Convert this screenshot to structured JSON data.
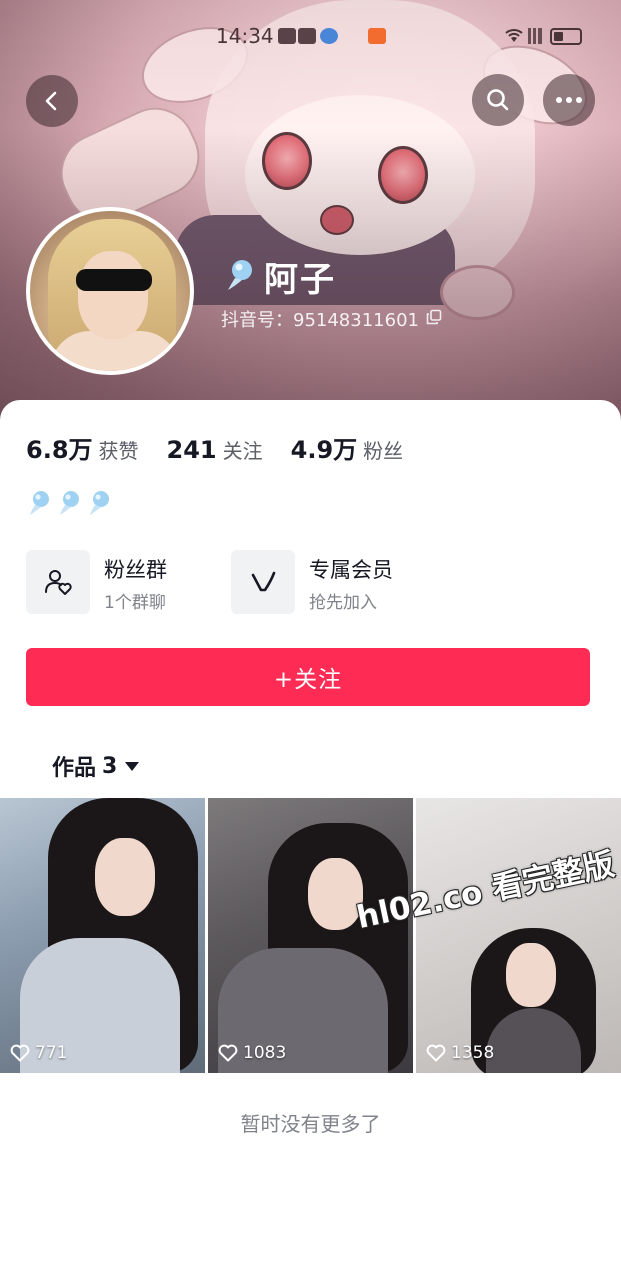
{
  "status_bar": {
    "time": "14:34",
    "icons": [
      "app-icon",
      "app-icon",
      "browser-icon",
      "app-icon",
      "wifi-icon",
      "signal-icon",
      "battery-icon"
    ]
  },
  "profile": {
    "nickname": "阿子",
    "douyin_id": "抖音号：95148311601"
  },
  "stats": {
    "likes_value": "6.8万",
    "likes_label": "获赞",
    "following_value": "241",
    "following_label": "关注",
    "followers_value": "4.9万",
    "followers_label": "粉丝"
  },
  "features": {
    "fans_group_title": "粉丝群",
    "fans_group_sub": "1个群聊",
    "vip_title": "专属会员",
    "vip_sub": "抢先加入"
  },
  "follow_button": "+关注",
  "works_tab": {
    "label": "作品",
    "count": "3"
  },
  "videos": [
    {
      "likes": "771"
    },
    {
      "likes": "1083"
    },
    {
      "likes": "1358"
    }
  ],
  "watermark": "hl02.co 看完整版",
  "end_text": "暂时没有更多了",
  "colors": {
    "accent": "#fe2c55",
    "text_primary": "#161823",
    "text_secondary": "#80838a"
  }
}
